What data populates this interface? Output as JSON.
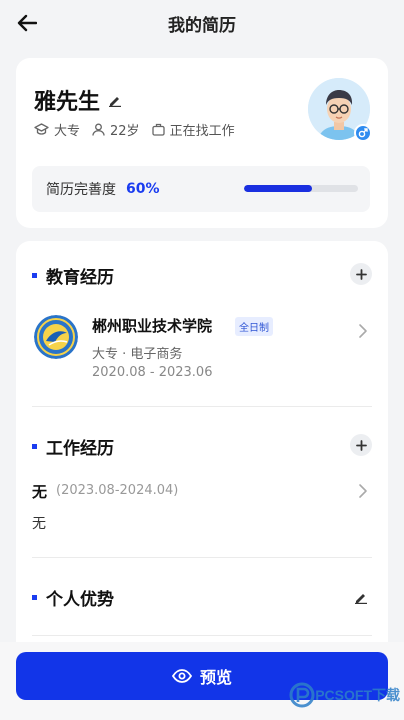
{
  "header": {
    "title": "我的简历"
  },
  "profile": {
    "name": "雅先生",
    "education": "大专",
    "age": "22岁",
    "status": "正在找工作",
    "completeness_label": "简历完善度",
    "completeness_value": "60%",
    "completeness_fraction": 0.6
  },
  "sections": {
    "education": {
      "title": "教育经历",
      "school": "郴州职业技术学院",
      "tag": "全日制",
      "degree": "大专",
      "major": "电子商务",
      "dates": "2020.08 - 2023.06"
    },
    "work": {
      "title": "工作经历",
      "entry_title": "无",
      "entry_period": "(2023.08-2024.04)",
      "entry_desc": "无"
    },
    "advantages": {
      "title": "个人优势"
    }
  },
  "footer": {
    "preview_label": "预览",
    "watermark": "PCSOFT下载"
  },
  "colors": {
    "accent": "#1235e8",
    "gender": "#2f8cf0",
    "tag_bg": "#e7edff"
  },
  "icons": [
    "arrow-left-icon",
    "pencil-icon",
    "graduation-cap-icon",
    "person-icon",
    "briefcase-icon",
    "male-icon",
    "plus-icon",
    "chevron-right-icon",
    "eye-icon"
  ]
}
